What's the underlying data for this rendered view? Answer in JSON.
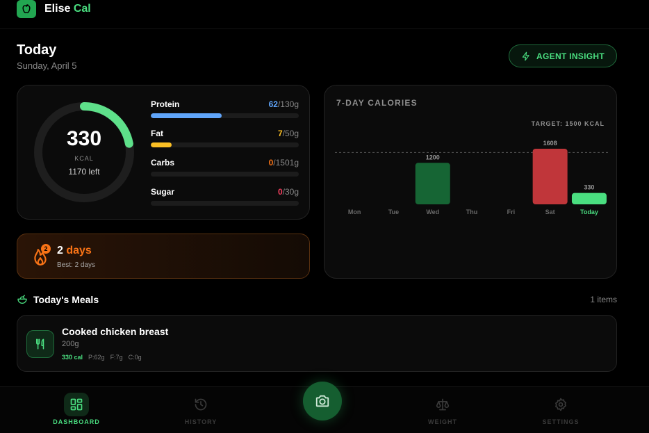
{
  "app": {
    "name_primary": "Elise",
    "name_accent": "Cal"
  },
  "page": {
    "title": "Today",
    "date": "Sunday, April 5"
  },
  "insight_button": {
    "label": "AGENT INSIGHT"
  },
  "summary": {
    "calories": "330",
    "unit": "KCAL",
    "remaining": "1170 left",
    "progress_fraction": 0.22
  },
  "macros": [
    {
      "name": "Protein",
      "current": "62",
      "target": "/130g",
      "fraction": 0.477,
      "color": "#60a5fa"
    },
    {
      "name": "Fat",
      "current": "7",
      "target": "/50g",
      "fraction": 0.14,
      "color": "#fbbf24"
    },
    {
      "name": "Carbs",
      "current": "0",
      "target": "/1501g",
      "fraction": 0,
      "color": "#f97316"
    },
    {
      "name": "Sugar",
      "current": "0",
      "target": "/30g",
      "fraction": 0,
      "color": "#f43f5e"
    }
  ],
  "streak": {
    "badge": "2",
    "count": "2",
    "unit": "days",
    "best": "Best: 2 days"
  },
  "chart_data": {
    "type": "bar",
    "title": "7-DAY CALORIES",
    "target_label": "TARGET: 1500 KCAL",
    "target": 1500,
    "categories": [
      "Mon",
      "Tue",
      "Wed",
      "Thu",
      "Fri",
      "Sat",
      "Today"
    ],
    "values": [
      0,
      0,
      1200,
      0,
      0,
      1608,
      330
    ],
    "value_labels": [
      "",
      "",
      "1200",
      "",
      "",
      "1608",
      "330"
    ],
    "bar_colors": [
      "#1c1c1c",
      "#1c1c1c",
      "#166534",
      "#1c1c1c",
      "#1c1c1c",
      "#c0363a",
      "#4ade80"
    ],
    "ylim": [
      0,
      1608
    ]
  },
  "meals": {
    "title": "Today's Meals",
    "count": "1 items",
    "items": [
      {
        "name": "Cooked chicken breast",
        "quantity": "200g",
        "calories": "330 cal",
        "protein": "P:62g",
        "fat": "F:7g",
        "carbs": "C:0g"
      }
    ]
  },
  "nav": [
    {
      "label": "DASHBOARD",
      "icon": "dashboard-icon",
      "active": true
    },
    {
      "label": "HISTORY",
      "icon": "history-icon",
      "active": false
    },
    {
      "label": "WEIGHT",
      "icon": "scale-icon",
      "active": false
    },
    {
      "label": "SETTINGS",
      "icon": "gear-icon",
      "active": false
    }
  ],
  "colors": {
    "accent": "#4ade80",
    "streak": "#f97316",
    "background": "#000000"
  }
}
